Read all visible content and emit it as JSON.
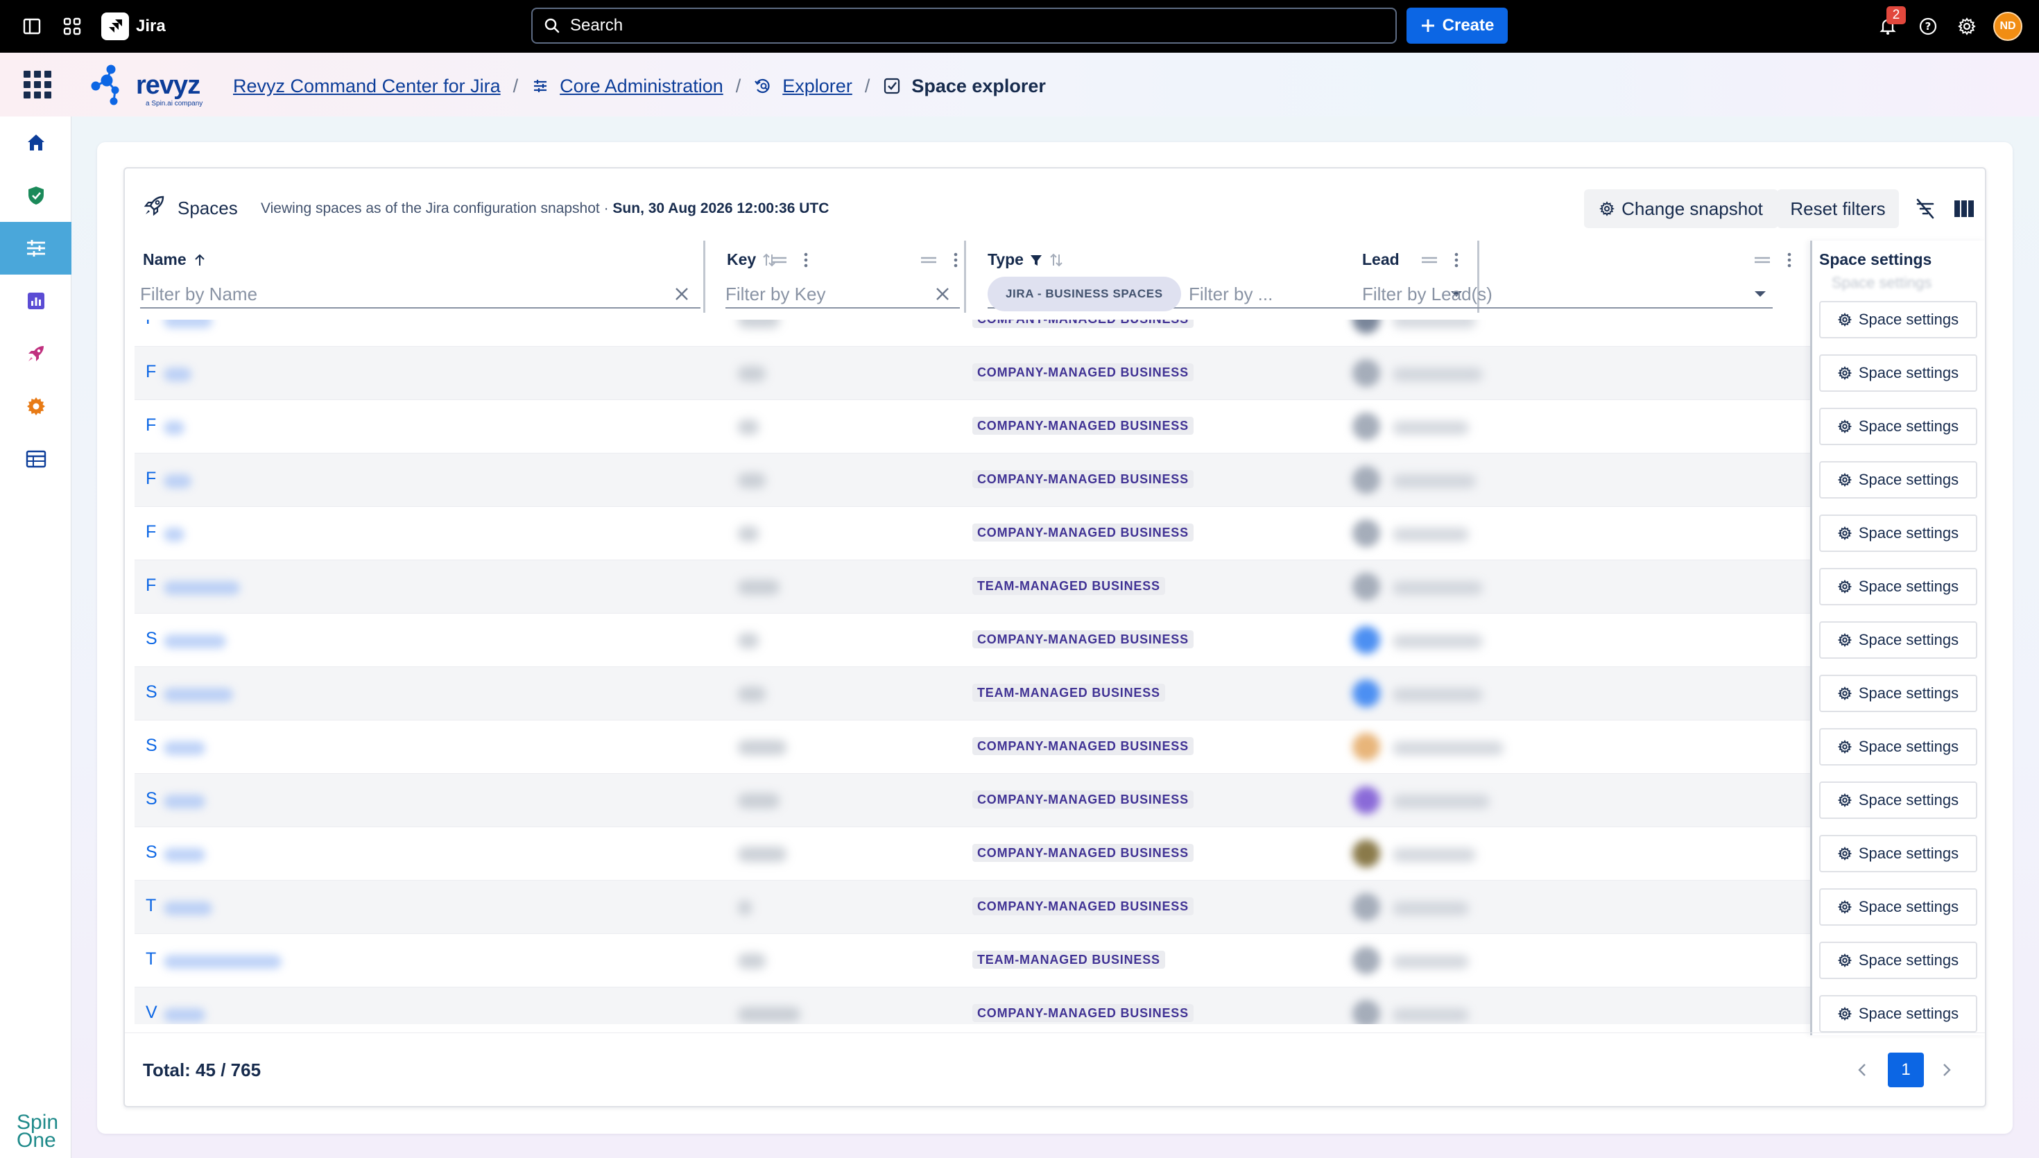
{
  "topbar": {
    "app_name": "Jira",
    "search_placeholder": "Search",
    "create_label": "Create",
    "notification_count": "2",
    "avatar_initials": "ND"
  },
  "header": {
    "logo_text": "revyz",
    "logo_tagline": "a Spin.ai company",
    "breadcrumb": [
      {
        "label": "Revyz Command Center for Jira",
        "icon": "revyz-icon"
      },
      {
        "label": "Core Administration",
        "icon": "sliders-icon"
      },
      {
        "label": "Explorer",
        "icon": "explorer-icon"
      },
      {
        "label": "Space explorer",
        "icon": "check-square-icon"
      }
    ]
  },
  "sidebar": {
    "items": [
      "home-icon",
      "shield-icon",
      "sliders-icon",
      "chart-icon",
      "rocket-icon",
      "gear-icon",
      "table-icon"
    ],
    "active_index": 2,
    "footer_logo": "Spin One"
  },
  "panel": {
    "title": "Spaces",
    "subtitle": "Viewing spaces as of the Jira configuration snapshot · ",
    "snapshot_date": "Sun, 30 Aug 2026 12:00:36 UTC",
    "change_snapshot_label": "Change snapshot",
    "reset_filters_label": "Reset filters"
  },
  "columns": {
    "name": {
      "title": "Name",
      "filter_placeholder": "Filter by Name"
    },
    "key": {
      "title": "Key",
      "filter_placeholder": "Filter by Key"
    },
    "type": {
      "title": "Type",
      "chip": "JIRA - BUSINESS SPACES",
      "filter_placeholder": "Filter by ..."
    },
    "lead": {
      "title": "Lead",
      "filter_placeholder": "Filter by Lead(s)"
    },
    "settings": {
      "title": "Space settings"
    }
  },
  "rows": [
    {
      "initial": "F",
      "type": "COMPANY-MANAGED BUSINESS",
      "lead_color": "#7a869a"
    },
    {
      "initial": "F",
      "type": "COMPANY-MANAGED BUSINESS",
      "lead_color": "#a5adba"
    },
    {
      "initial": "F",
      "type": "COMPANY-MANAGED BUSINESS",
      "lead_color": "#a5adba"
    },
    {
      "initial": "F",
      "type": "COMPANY-MANAGED BUSINESS",
      "lead_color": "#a5adba"
    },
    {
      "initial": "F",
      "type": "COMPANY-MANAGED BUSINESS",
      "lead_color": "#a5adba"
    },
    {
      "initial": "F",
      "type": "TEAM-MANAGED BUSINESS",
      "lead_color": "#a5adba"
    },
    {
      "initial": "S",
      "type": "COMPANY-MANAGED BUSINESS",
      "lead_color": "#4c8ff2"
    },
    {
      "initial": "S",
      "type": "TEAM-MANAGED BUSINESS",
      "lead_color": "#4c8ff2"
    },
    {
      "initial": "S",
      "type": "COMPANY-MANAGED BUSINESS",
      "lead_color": "#e8b57a"
    },
    {
      "initial": "S",
      "type": "COMPANY-MANAGED BUSINESS",
      "lead_color": "#8a6ad8"
    },
    {
      "initial": "S",
      "type": "COMPANY-MANAGED BUSINESS",
      "lead_color": "#8a7a4a"
    },
    {
      "initial": "T",
      "type": "COMPANY-MANAGED BUSINESS",
      "lead_color": "#a5adba"
    },
    {
      "initial": "T",
      "type": "TEAM-MANAGED BUSINESS",
      "lead_color": "#a5adba"
    },
    {
      "initial": "V",
      "type": "COMPANY-MANAGED BUSINESS",
      "lead_color": "#a5adba"
    }
  ],
  "space_settings_label": "Space settings",
  "footer": {
    "total": "Total: 45 / 765",
    "current_page": "1"
  },
  "colors": {
    "accent": "#0c66e4",
    "active_nav": "#4aa7da",
    "type_text": "#403294"
  }
}
